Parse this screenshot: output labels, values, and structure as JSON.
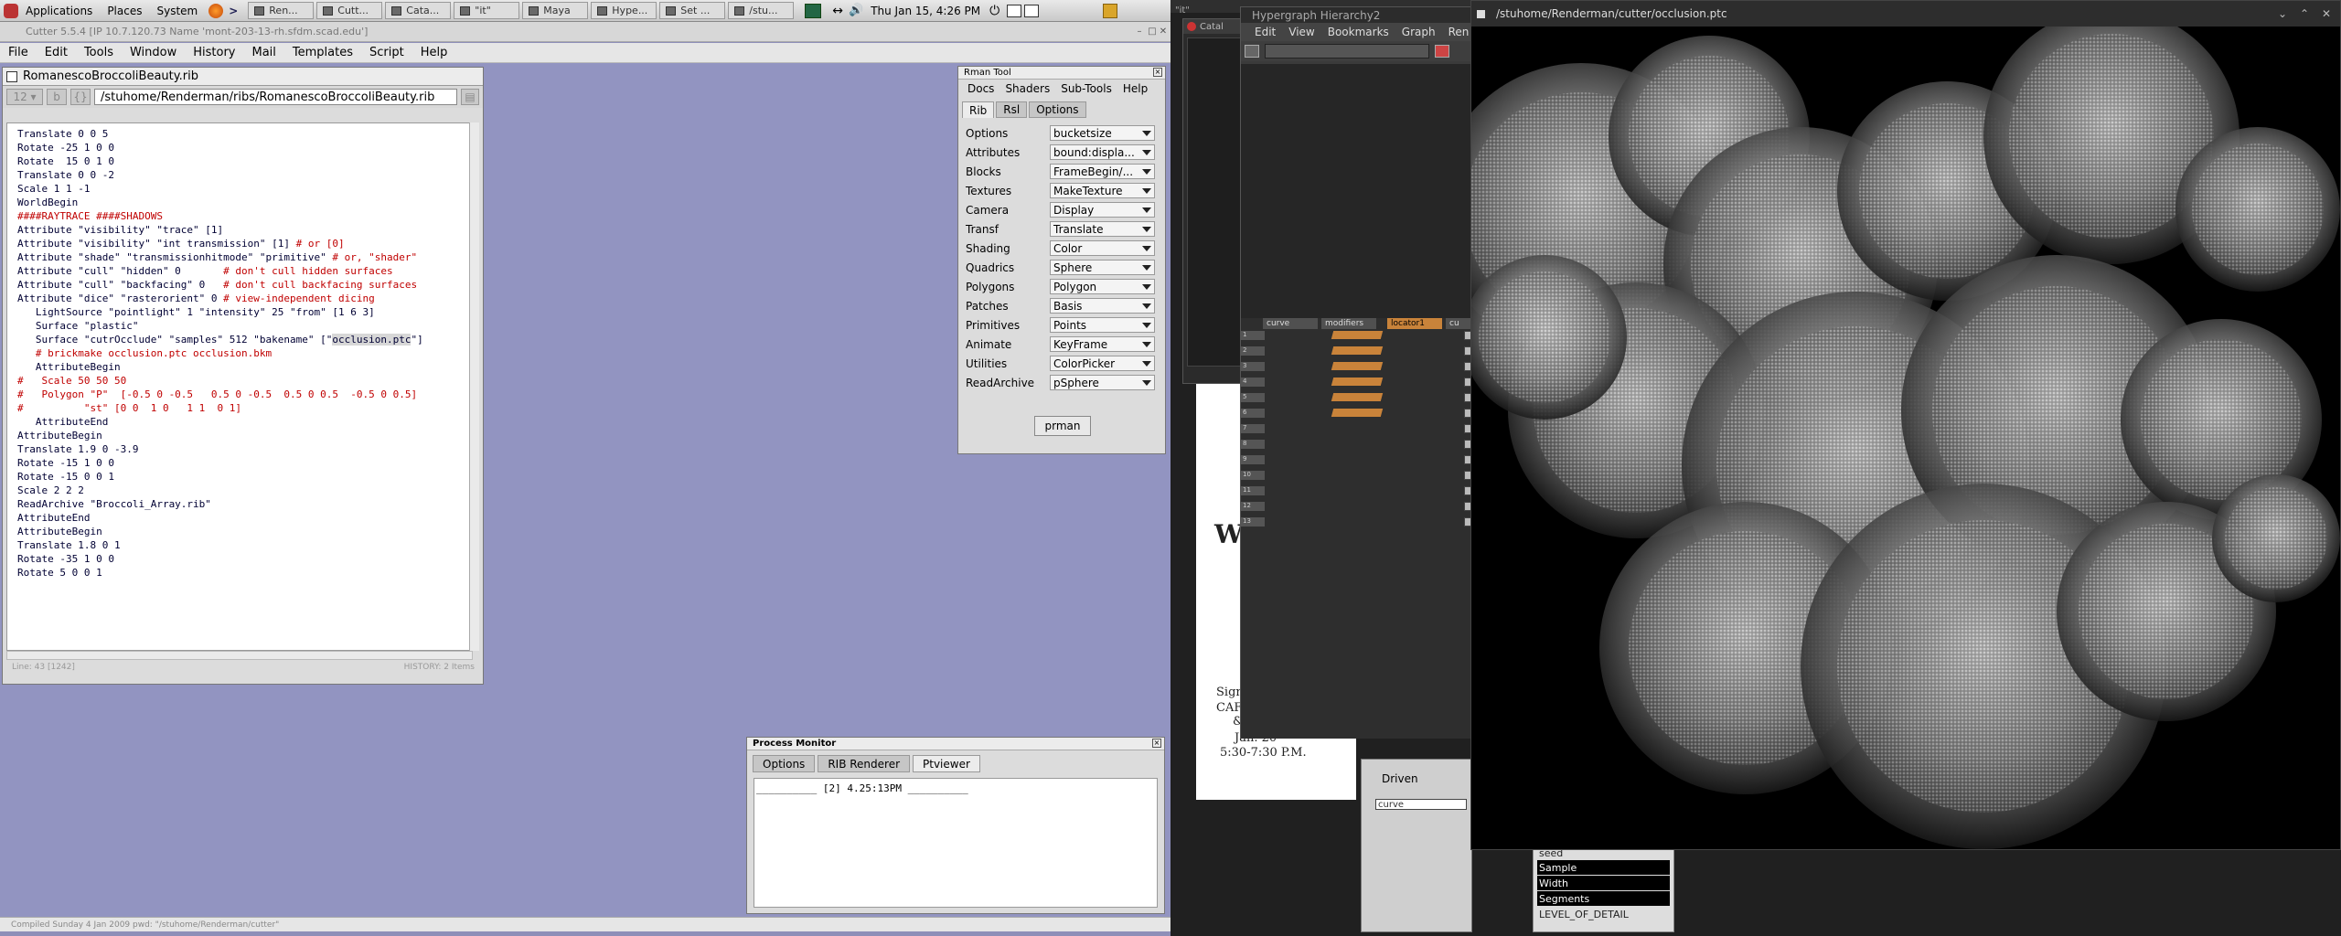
{
  "top_panel": {
    "applications": "Applications",
    "places": "Places",
    "system": "System",
    "tasks": [
      "Ren...",
      "Cutt...",
      "Cata...",
      "\"it\"",
      "Maya",
      "Hype...",
      "Set ...",
      "/stu..."
    ],
    "clock": "Thu Jan 15,  4:26 PM"
  },
  "cutter": {
    "title": "Cutter 5.5.4   [IP 10.7.120.73 Name 'mont-203-13-rh.sfdm.scad.edu']",
    "menu": [
      "File",
      "Edit",
      "Tools",
      "Window",
      "History",
      "Mail",
      "Templates",
      "Script",
      "Help"
    ],
    "statusbar": "Compiled Sunday 4 Jan 2009   pwd: \"/stuhome/Renderman/cutter\""
  },
  "editor": {
    "title": "RomanescoBroccoliBeauty.rib",
    "font_size": "12",
    "bold_btn": "b",
    "brace_btn": "{}",
    "path": "/stuhome/Renderman/ribs/RomanescoBroccoliBeauty.rib",
    "status_left": "Line: 43 [1242]",
    "status_right": "HISTORY: 2 Items",
    "lines": [
      {
        "t": "Translate 0 0 5"
      },
      {
        "t": "Rotate -25 1 0 0"
      },
      {
        "t": "Rotate  15 0 1 0"
      },
      {
        "t": "Translate 0 0 -2"
      },
      {
        "t": "Scale 1 1 -1"
      },
      {
        "t": "WorldBegin"
      },
      {
        "t": ""
      },
      {
        "t": "####RAYTRACE ####SHADOWS",
        "c": true
      },
      {
        "t": "Attribute \"visibility\" \"trace\" [1]"
      },
      {
        "t": "Attribute \"visibility\" \"int transmission\" [1]",
        "cm": " # or [0]"
      },
      {
        "t": "Attribute \"shade\" \"transmissionhitmode\" \"primitive\"",
        "cm": " # or, \"shader\""
      },
      {
        "t": "Attribute \"cull\" \"hidden\" 0      ",
        "cm": " # don't cull hidden surfaces"
      },
      {
        "t": "Attribute \"cull\" \"backfacing\" 0  ",
        "cm": " # don't cull backfacing surfaces"
      },
      {
        "t": "Attribute \"dice\" \"rasterorient\" 0",
        "cm": " # view-independent dicing"
      },
      {
        "t": ""
      },
      {
        "t": "   LightSource \"pointlight\" 1 \"intensity\" 25 \"from\" [1 6 3]"
      },
      {
        "t": "   Surface \"plastic\""
      },
      {
        "t": ""
      },
      {
        "t": ""
      },
      {
        "t": "   Surface \"cutrOcclude\" \"samples\" 512 \"bakename\" [\"",
        "hl": "occlusion.ptc",
        "after": "\"]"
      },
      {
        "t": "   # brickmake occlusion.ptc occlusion.bkm",
        "c": true
      },
      {
        "t": ""
      },
      {
        "t": "   AttributeBegin"
      },
      {
        "t": "#   Scale 50 50 50",
        "c": true
      },
      {
        "t": "#   Polygon \"P\"  [-0.5 0 -0.5   0.5 0 -0.5  0.5 0 0.5  -0.5 0 0.5]",
        "c": true
      },
      {
        "t": "#          \"st\" [0 0  1 0   1 1  0 1]",
        "c": true
      },
      {
        "t": "   AttributeEnd"
      },
      {
        "t": ""
      },
      {
        "t": "AttributeBegin"
      },
      {
        "t": "Translate 1.9 0 -3.9"
      },
      {
        "t": "Rotate -15 1 0 0"
      },
      {
        "t": "Rotate -15 0 0 1"
      },
      {
        "t": "Scale 2 2 2"
      },
      {
        "t": "ReadArchive \"Broccoli_Array.rib\""
      },
      {
        "t": "AttributeEnd"
      },
      {
        "t": "AttributeBegin"
      },
      {
        "t": "Translate 1.8 0 1"
      },
      {
        "t": "Rotate -35 1 0 0"
      },
      {
        "t": "Rotate 5 0 0 1"
      }
    ]
  },
  "rman_tool": {
    "title": "Rman Tool",
    "menu": [
      "Docs",
      "Shaders",
      "Sub-Tools",
      "Help"
    ],
    "tabs": [
      "Rib",
      "Rsl",
      "Options"
    ],
    "rows": [
      {
        "label": "Options",
        "value": "bucketsize"
      },
      {
        "label": "Attributes",
        "value": "bound:displa..."
      },
      {
        "label": "Blocks",
        "value": "FrameBegin/..."
      },
      {
        "label": "Textures",
        "value": "MakeTexture"
      },
      {
        "label": "Camera",
        "value": "Display"
      },
      {
        "label": "Transf",
        "value": "Translate"
      },
      {
        "label": "Shading",
        "value": "Color"
      },
      {
        "label": "Quadrics",
        "value": "Sphere"
      },
      {
        "label": "Polygons",
        "value": "Polygon"
      },
      {
        "label": "Patches",
        "value": "Basis"
      },
      {
        "label": "Primitives",
        "value": "Points"
      },
      {
        "label": "Animate",
        "value": "KeyFrame"
      },
      {
        "label": "Utilities",
        "value": "ColorPicker"
      },
      {
        "label": "ReadArchive",
        "value": "pSphere"
      }
    ],
    "button": "prman"
  },
  "process_monitor": {
    "title": "Process Monitor",
    "tabs": [
      "Options",
      "RIB Renderer",
      "Ptviewer"
    ],
    "log": "__________ [2] 4.25:13PM __________"
  },
  "right_screen": {
    "bg_window_title": "\"it\"",
    "catalog_title": "Catal",
    "hypergraph": {
      "title": "Hypergraph Hierarchy2",
      "menu": [
        "Edit",
        "View",
        "Bookmarks",
        "Graph",
        "Ren"
      ],
      "nodes": [
        "curve",
        "modifiers",
        "locator1",
        "cu"
      ],
      "rows": [
        "1",
        "2",
        "3",
        "4",
        "5",
        "6",
        "7",
        "8",
        "9",
        "10",
        "11",
        "12",
        "13"
      ]
    },
    "poster": {
      "big": "Wi",
      "line1": "Sign",
      "line2": "CAFE",
      "line3": "&",
      "date": "Jan. 20",
      "time": "5:30-7:30 P.M."
    },
    "driven": {
      "label": "Driven",
      "input": "curve"
    },
    "attr_list": {
      "items": [
        "seed",
        "Sample",
        "Width",
        "Segments",
        "LEVEL_OF_DETAIL"
      ],
      "selected": [
        false,
        true,
        true,
        true,
        false
      ]
    },
    "ptc_viewer": {
      "title": "/stuhome/Renderman/cutter/occlusion.ptc"
    }
  }
}
